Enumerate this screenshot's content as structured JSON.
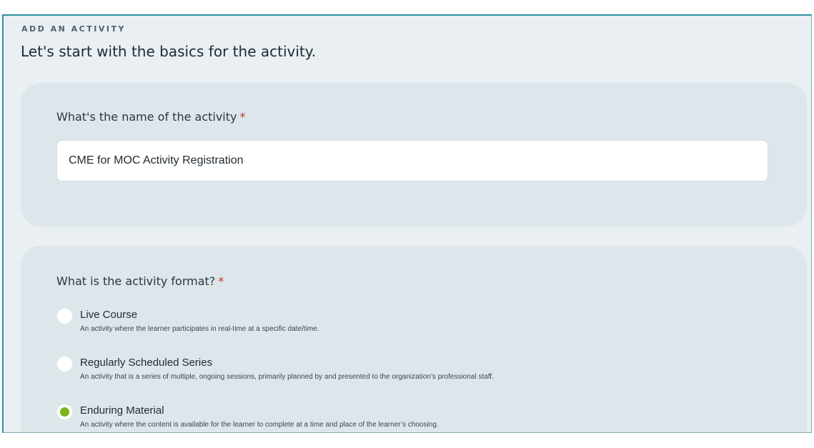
{
  "form": {
    "eyebrow": "ADD AN ACTIVITY",
    "headline": "Let's start with the basics for the activity."
  },
  "name_question": {
    "label": "What's the name of the activity",
    "required_mark": "*",
    "value": "CME for MOC Activity Registration"
  },
  "format_question": {
    "label": "What is the activity format?",
    "required_mark": "*",
    "selected": "Enduring Material",
    "options": [
      {
        "title": "Live Course",
        "description": "An activity where the learner participates in real-time at a specific date/time.",
        "checked": false
      },
      {
        "title": "Regularly Scheduled Series",
        "description": "An activity that is a series of multiple, ongoing sessions, primarily planned by and presented to the organization’s professional staff.",
        "checked": false
      },
      {
        "title": "Enduring Material",
        "description": "An activity where the content is available for the learner to complete at a time and place of the learner’s choosing.",
        "checked": true
      }
    ]
  },
  "colors": {
    "accent_border": "#2f8fa3",
    "radio_selected": "#7cb518",
    "required": "#c0392b",
    "card_bg": "#dde6ea"
  }
}
